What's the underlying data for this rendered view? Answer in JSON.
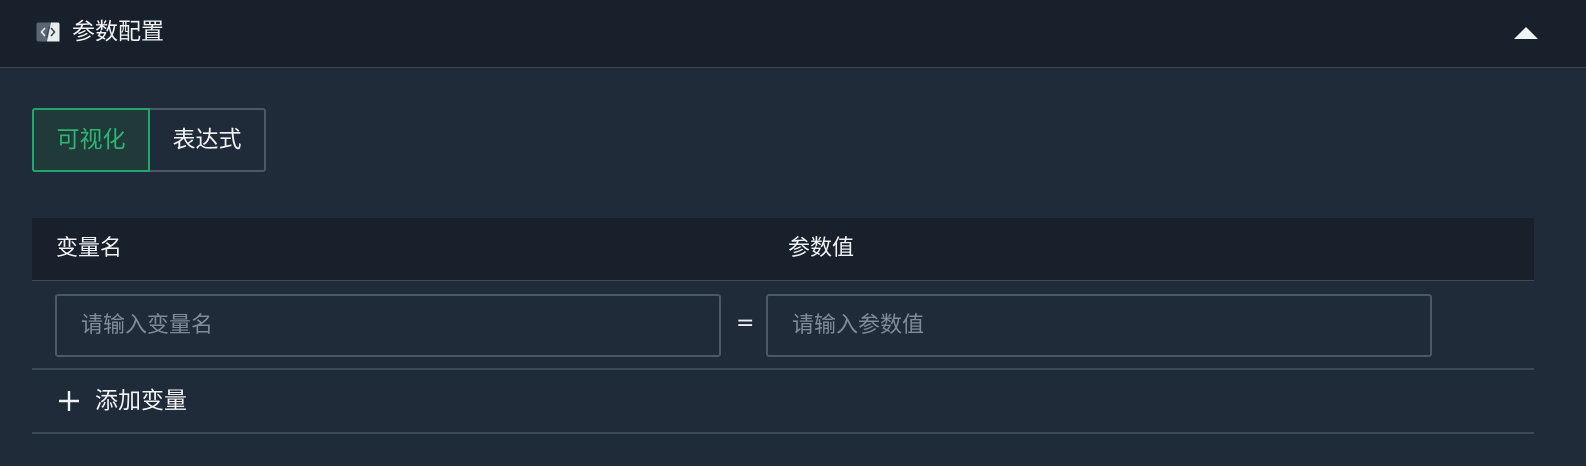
{
  "header": {
    "title": "参数配置",
    "icon": "code-file-icon",
    "collapse_icon": "caret-up-icon"
  },
  "mode_toggle": {
    "options": [
      {
        "label": "可视化",
        "selected": true
      },
      {
        "label": "表达式",
        "selected": false
      }
    ]
  },
  "table": {
    "columns": [
      "变量名",
      "参数值"
    ],
    "rows": [
      {
        "name_placeholder": "请输入变量名",
        "name_value": "",
        "separator": "=",
        "value_placeholder": "请输入参数值",
        "value_value": ""
      }
    ]
  },
  "add_variable": {
    "label": "添加变量",
    "icon": "plus-icon"
  },
  "colors": {
    "background": "#1f2b38",
    "header_background": "#18202c",
    "accent": "#20a86a",
    "border": "#4b5866"
  }
}
